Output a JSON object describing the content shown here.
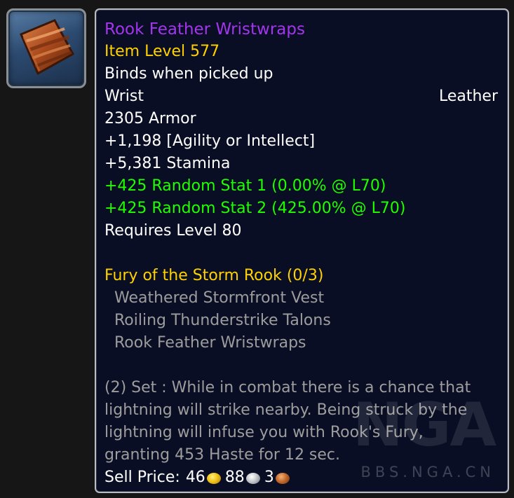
{
  "item": {
    "icon": "leather-wristwraps-icon",
    "name": "Rook Feather Wristwraps",
    "item_level": "Item Level 577",
    "binding": "Binds when picked up",
    "slot": "Wrist",
    "armor_type": "Leather",
    "armor": "2305 Armor",
    "primary_stat": "+1,198 [Agility or Intellect]",
    "stamina": "+5,381 Stamina",
    "random_stat_1": "+425 Random Stat 1 (0.00% @ L70)",
    "random_stat_2": "+425 Random Stat 2 (425.00% @ L70)",
    "requires_level": "Requires Level 80"
  },
  "set": {
    "name": "Fury of the Storm Rook (0/3)",
    "pieces": [
      "Weathered Stormfront Vest",
      "Roiling Thunderstrike Talons",
      "Rook Feather Wristwraps"
    ],
    "bonus_lines": [
      "(2) Set : While in combat there is a chance that",
      "lightning will strike nearby. Being struck by the",
      "lightning will infuse you with Rook's Fury,",
      "granting 453 Haste for 12 sec."
    ]
  },
  "sell_price": {
    "label": "Sell Price:",
    "gold": "46",
    "silver": "88",
    "copper": "3"
  },
  "watermark": {
    "logo": "NGA",
    "url": "BBS.NGA.CN"
  },
  "colors": {
    "epic": "#a335ee",
    "item_level": "#ffd100",
    "bonus_stat": "#1eff00",
    "set_inactive": "#9d9d9d",
    "tooltip_bg": "#0a0e24"
  }
}
